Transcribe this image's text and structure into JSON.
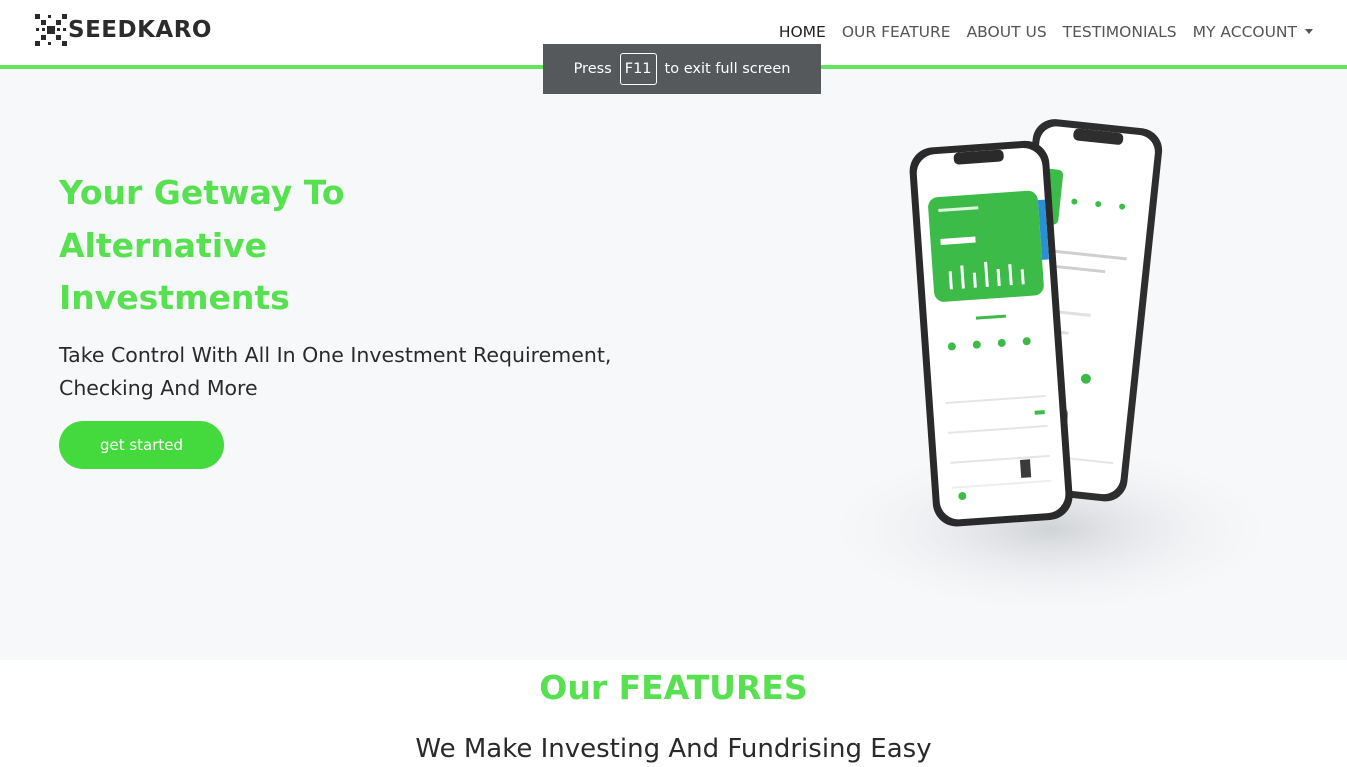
{
  "brand": {
    "name": "SEEDKARO"
  },
  "nav": {
    "items": [
      {
        "label": "HOME",
        "active": true
      },
      {
        "label": "OUR FEATURE"
      },
      {
        "label": "ABOUT US"
      },
      {
        "label": "TESTIMONIALS"
      },
      {
        "label": "MY ACCOUNT",
        "dropdown": true
      }
    ]
  },
  "fullscreen_toast": {
    "prefix": "Press",
    "key": "F11",
    "suffix": "to exit full screen"
  },
  "hero": {
    "title_lines": [
      "Your Getway To",
      "Alternative",
      "Investments"
    ],
    "subtitle_lines": [
      "Take Control With All In One Investment Requirement,",
      "Checking And More"
    ],
    "cta_label": "get started"
  },
  "features": {
    "title": "Our FEATURES",
    "subtitle": "We Make Investing And Fundrising Easy"
  },
  "colors": {
    "accent": "#57e04f",
    "button": "#44d93c",
    "header_line": "#62e55a",
    "hero_bg": "#f7f8fa"
  }
}
